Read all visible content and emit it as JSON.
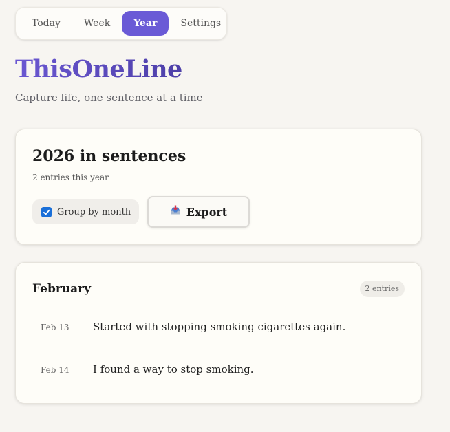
{
  "nav": {
    "tabs": [
      {
        "label": "Today"
      },
      {
        "label": "Week"
      },
      {
        "label": "Year"
      },
      {
        "label": "Settings"
      }
    ],
    "active_tab": "Year"
  },
  "brand": {
    "title": "ThisOneLine",
    "tagline": "Capture life, one sentence at a time"
  },
  "year_card": {
    "title": "2026 in sentences",
    "subtitle": "2 entries this year",
    "group_by_month": {
      "label": "Group by month",
      "checked": true
    },
    "export": {
      "label": "Export",
      "icon": "inbox-tray-icon"
    }
  },
  "month_card": {
    "title": "February",
    "count": "2 entries",
    "entries": [
      {
        "date": "Feb 13",
        "text": "Started with stopping smoking cigarettes again."
      },
      {
        "date": "Feb 14",
        "text": "I found a way to stop smoking."
      }
    ]
  },
  "colors": {
    "accent": "#6a5ad6",
    "checkbox": "#1a6fd8",
    "background": "#f7f5f1",
    "card": "#fefdf8"
  }
}
